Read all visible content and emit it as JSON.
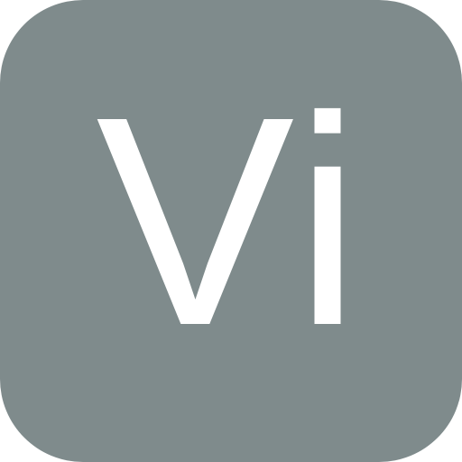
{
  "icon": {
    "label": "Vi",
    "background_color": "#7f8b8c",
    "text_color": "#ffffff"
  }
}
